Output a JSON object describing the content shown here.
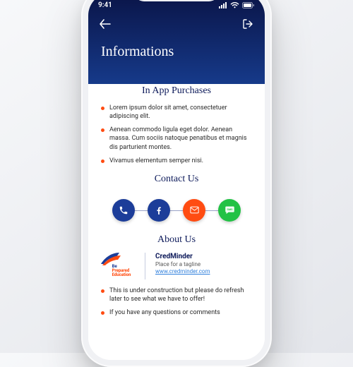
{
  "status": {
    "time": "9:41",
    "battery_icon": "battery-icon",
    "wifi_icon": "wifi-icon",
    "signal_icon": "signal-icon"
  },
  "nav": {
    "back": "back",
    "exit": "exit"
  },
  "title": "Informations",
  "iap": {
    "heading": "In App Purchases",
    "items": [
      "Lorem ipsum dolor sit amet, consectetuer adipiscing elit.",
      "Aenean commodo ligula eget dolor. Aenean massa. Cum sociis natoque penatibus et magnis dis parturient montes.",
      "Vivamus elementum semper nisi."
    ]
  },
  "contact": {
    "heading": "Contact Us",
    "buttons": [
      {
        "name": "phone",
        "color": "c-phone"
      },
      {
        "name": "facebook",
        "color": "c-fb"
      },
      {
        "name": "email",
        "color": "c-mail"
      },
      {
        "name": "sms",
        "color": "c-sms"
      }
    ]
  },
  "about": {
    "heading": "About Us",
    "logo_line1": "Be",
    "logo_line2": "Prepared",
    "logo_line3": "Education",
    "brand": "CredMinder",
    "tagline": "Place for a tagline",
    "url": "www.credminder.com",
    "items": [
      "This is under construction but please do refresh later to see what we have to offer!",
      "If you have any questions or comments"
    ]
  }
}
